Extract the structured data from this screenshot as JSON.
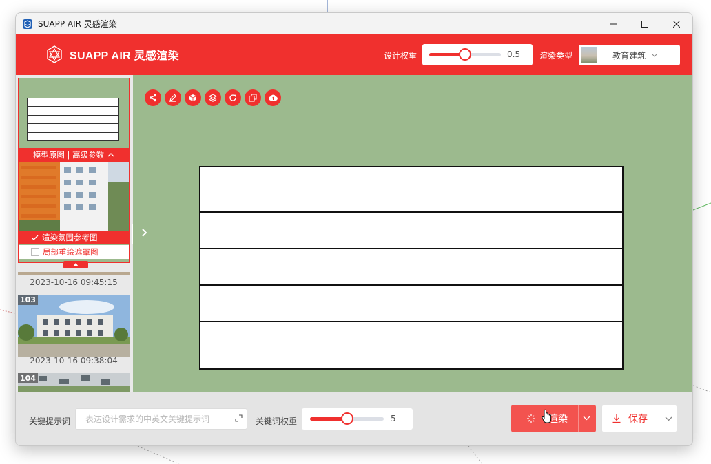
{
  "window": {
    "title": "SUAPP AIR 灵感渲染"
  },
  "header": {
    "brand": "SUAPP AIR 灵感渲染",
    "design_weight_label": "设计权重",
    "design_weight_value": "0.5",
    "design_weight_fraction": 0.5,
    "render_type_label": "渲染类型",
    "render_type_value": "教育建筑"
  },
  "sidebar": {
    "card_tabs": "模型原图 | 高级参数",
    "option_reference": "渲染氛围参考图",
    "option_mask": "局部重绘遮罩图",
    "history": [
      {
        "number": "",
        "date": "2023-10-16 09:45:15"
      },
      {
        "number": "103",
        "date": "2023-10-16 09:38:04"
      },
      {
        "number": "104",
        "date": ""
      }
    ]
  },
  "toolbar": {
    "icons": [
      "share-icon",
      "edit-icon",
      "cube-icon",
      "layers-icon",
      "refresh-icon",
      "copy-icon",
      "cloud-upload-icon"
    ]
  },
  "bottom": {
    "prompt_label": "关键提示词",
    "prompt_placeholder": "表达设计需求的中英文关键提示词",
    "prompt_value": "",
    "keyword_weight_label": "关键词权重",
    "keyword_weight_value": "5",
    "keyword_weight_fraction": 0.5,
    "render_label": "渲染",
    "save_label": "保存"
  },
  "colors": {
    "accent": "#f0302e",
    "canvas": "#9cba8e",
    "render_button": "#f3534f"
  }
}
